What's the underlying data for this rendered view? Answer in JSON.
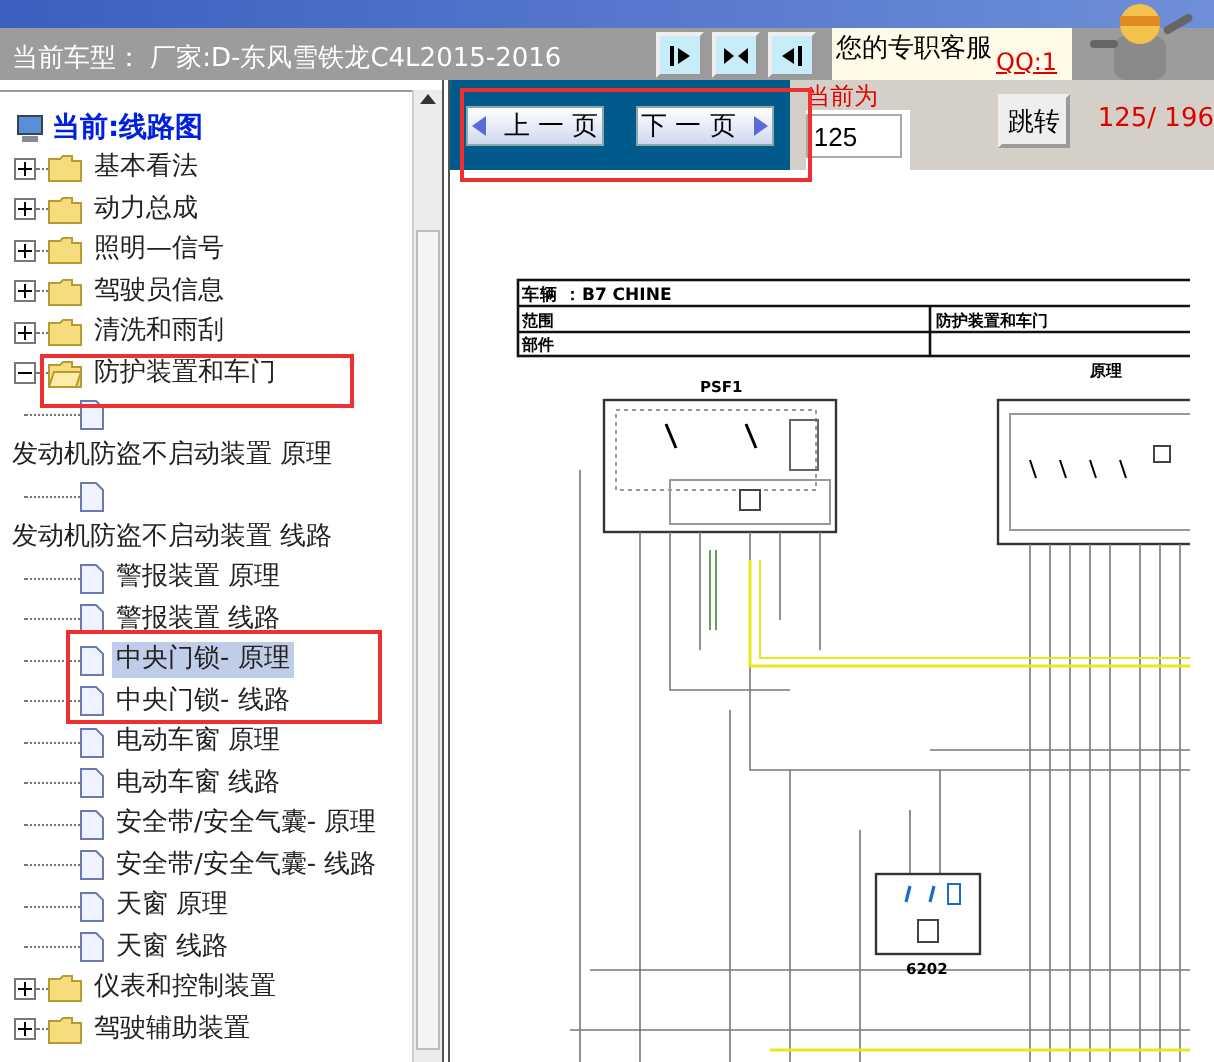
{
  "header": {
    "vehicle": "当前车型：  厂家:D-东风雪铁龙C4L2015-2016",
    "support_text": "您的专职客服",
    "qq_link": "QQ:1"
  },
  "layout_buttons": [
    {
      "kind": "right"
    },
    {
      "kind": "split"
    },
    {
      "kind": "left"
    }
  ],
  "tree": {
    "root": "当前:线路图",
    "items": [
      {
        "kind": "folder",
        "label": "基本看法",
        "expanded": false
      },
      {
        "kind": "folder",
        "label": "动力总成",
        "expanded": false
      },
      {
        "kind": "folder",
        "label": "照明—信号",
        "expanded": false
      },
      {
        "kind": "folder",
        "label": "驾驶员信息",
        "expanded": false
      },
      {
        "kind": "folder",
        "label": "清洗和雨刮",
        "expanded": false
      },
      {
        "kind": "folder",
        "label": "防护装置和车门",
        "expanded": true,
        "children": [
          {
            "kind": "page",
            "label": "发动机防盗不启动装置 原理",
            "selected": false
          },
          {
            "kind": "page",
            "label": "发动机防盗不启动装置 线路",
            "selected": false
          },
          {
            "kind": "page",
            "label": "警报装置 原理",
            "selected": false
          },
          {
            "kind": "page",
            "label": "警报装置 线路",
            "selected": false
          },
          {
            "kind": "page",
            "label": "中央门锁- 原理",
            "selected": true
          },
          {
            "kind": "page",
            "label": "中央门锁- 线路",
            "selected": false
          },
          {
            "kind": "page",
            "label": "电动车窗 原理",
            "selected": false
          },
          {
            "kind": "page",
            "label": "电动车窗 线路",
            "selected": false
          },
          {
            "kind": "page",
            "label": "安全带/安全气囊- 原理",
            "selected": false
          },
          {
            "kind": "page",
            "label": "安全带/安全气囊- 线路",
            "selected": false
          },
          {
            "kind": "page",
            "label": "天窗 原理",
            "selected": false
          },
          {
            "kind": "page",
            "label": "天窗 线路",
            "selected": false
          }
        ]
      },
      {
        "kind": "folder",
        "label": "仪表和控制装置",
        "expanded": false
      },
      {
        "kind": "folder",
        "label": "驾驶辅助装置",
        "expanded": false
      }
    ]
  },
  "pager": {
    "prev": "上 一 页",
    "next": "下 一 页",
    "current_label": "当前为",
    "current_value": "125",
    "jump": "跳转",
    "count": "125/ 196"
  },
  "diagram": {
    "vehicle": "车辆 ：B7 CHINE",
    "scope_label": "范围",
    "scope": "防护装置和车门",
    "part_label": "部件",
    "section": "原理",
    "module_1": "PSF1",
    "module_2": "6202"
  }
}
